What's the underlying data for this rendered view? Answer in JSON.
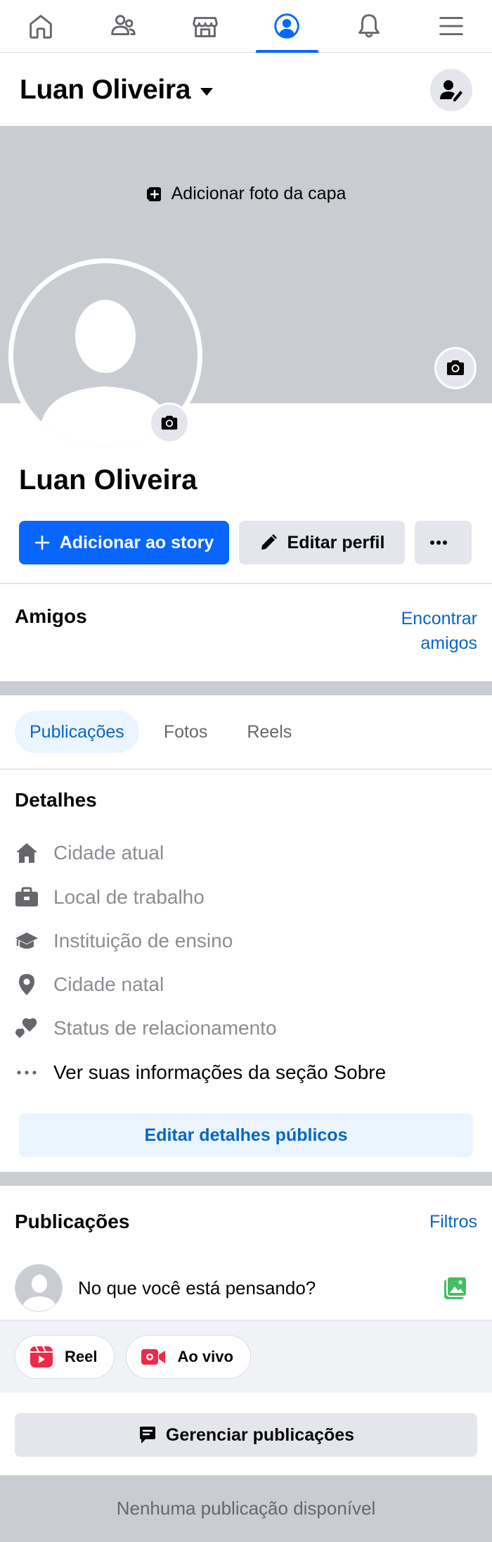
{
  "nav": {
    "items": [
      {
        "icon": "home-icon",
        "active": false
      },
      {
        "icon": "friends-icon",
        "active": false
      },
      {
        "icon": "marketplace-icon",
        "active": false
      },
      {
        "icon": "profile-icon",
        "active": true
      },
      {
        "icon": "bell-icon",
        "active": false
      },
      {
        "icon": "menu-icon",
        "active": false
      }
    ]
  },
  "header": {
    "name": "Luan Oliveira",
    "right_icon": "person-edit-icon"
  },
  "cover": {
    "add_label": "Adicionar foto da capa",
    "camera_icon": "camera-icon"
  },
  "profile": {
    "name": "Luan Oliveira"
  },
  "actions": {
    "add_story": "Adicionar ao story",
    "edit_profile": "Editar perfil",
    "more_icon": "more-icon"
  },
  "friends": {
    "title": "Amigos",
    "find_line1": "Encontrar",
    "find_line2": "amigos"
  },
  "tabs": [
    {
      "label": "Publicações",
      "active": true
    },
    {
      "label": "Fotos",
      "active": false
    },
    {
      "label": "Reels",
      "active": false
    }
  ],
  "details": {
    "title": "Detalhes",
    "rows": [
      {
        "icon": "house-icon",
        "label": "Cidade atual"
      },
      {
        "icon": "briefcase-icon",
        "label": "Local de trabalho"
      },
      {
        "icon": "graduation-cap-icon",
        "label": "Instituição de ensino"
      },
      {
        "icon": "location-pin-icon",
        "label": "Cidade natal"
      },
      {
        "icon": "hearts-icon",
        "label": "Status de relacionamento"
      },
      {
        "icon": "ellipsis-icon",
        "label": "Ver suas informações da seção Sobre"
      }
    ],
    "edit_button": "Editar detalhes públicos"
  },
  "posts": {
    "title": "Publicações",
    "filters": "Filtros",
    "composer_prompt": "No que você está pensando?",
    "reel": "Reel",
    "live": "Ao vivo",
    "manage": "Gerenciar publicações",
    "empty": "Nenhuma publicação disponível"
  },
  "colors": {
    "accent": "#0866ff",
    "link": "#0a66c2",
    "surface": "#e4e6eb",
    "cover": "#c9ccd1"
  }
}
